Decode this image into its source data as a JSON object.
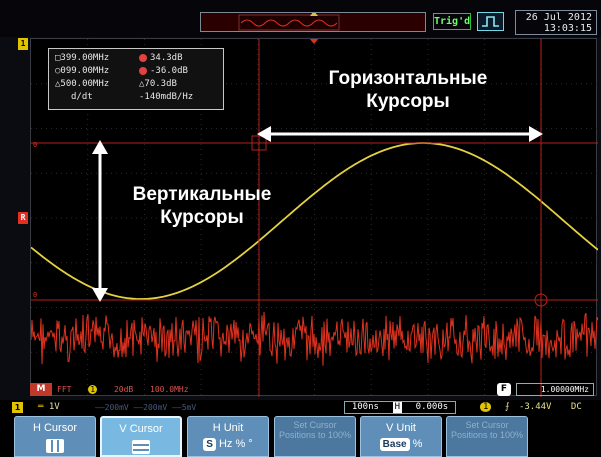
{
  "header": {
    "trigger_status": "Trig'd",
    "date": "26 Jul 2012",
    "time": "13:03:15"
  },
  "cursor_readout": {
    "row1_freq": "399.00MHz",
    "row1_level": "34.3dB",
    "row2_freq": "099.00MHz",
    "row2_level": "-36.0dB",
    "delta_freq": "△500.00MHz",
    "delta_level": "△70.3dB",
    "slope_label": "d/dt",
    "slope_value": "-140mdB/Hz"
  },
  "annotations": {
    "horizontal_line1": "Горизонтальные",
    "horizontal_line2": "Курсоры",
    "vertical_line1": "Вертикальные",
    "vertical_line2": "Курсоры"
  },
  "channel_markers": {
    "ch1": "1",
    "cursor_ref": "R"
  },
  "fft": {
    "badge": "M",
    "label": "FFT",
    "channel": "1",
    "scale": "20dB",
    "span": "100.0MHz"
  },
  "frequency_readout": {
    "badge": "F",
    "value": "1.00000MHz"
  },
  "status": {
    "ch1_num": "1",
    "ch1_volts": "1V",
    "faded": "——200mV ——200mV ——5mV",
    "timebase": "100ns",
    "delay_icon": "H",
    "delay": "0.000s",
    "trig_source": "1",
    "trig_level": "-3.44V",
    "coupling": "DC"
  },
  "softkeys": [
    {
      "label": "H Cursor",
      "icon": "h-cursor-icon"
    },
    {
      "label": "V Cursor",
      "icon": "v-cursor-icon"
    },
    {
      "label": "H Unit",
      "pill": "S",
      "rest": "Hz % °"
    },
    {
      "label": "Set Cursor Positions to 100%"
    },
    {
      "label": "V Unit",
      "pill": "Base",
      "rest": "%"
    },
    {
      "label": "Set Cursor Positions to 100%"
    }
  ],
  "colors": {
    "trace_yellow": "#e4d140",
    "trace_red": "#e0321e",
    "cursor_red": "#b8211a",
    "softkey_blue": "#5f8fb8"
  }
}
